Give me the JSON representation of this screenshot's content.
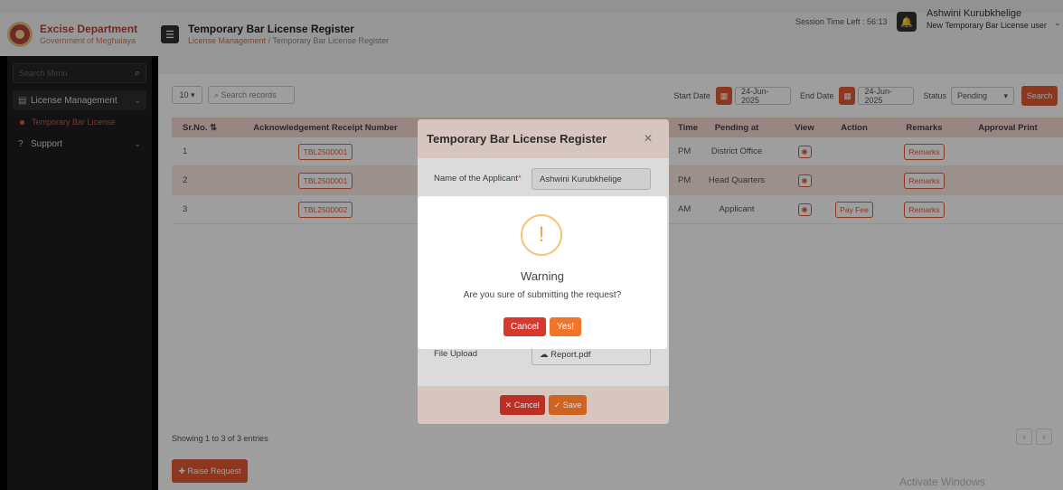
{
  "header": {
    "brand_title": "Excise Department",
    "brand_sub": "Government of Meghalaya",
    "page_title": "Temporary Bar License Register",
    "breadcrumb_link": "License Management",
    "breadcrumb_sep": " / ",
    "breadcrumb_current": "Temporary Bar License Register",
    "session_text": "Session Time Left : 56:13",
    "user_name": "Ashwini Kurubkhelige",
    "user_role": "New Temporary Bar License user"
  },
  "sidebar": {
    "search_placeholder": "Search Menu",
    "items": [
      {
        "label": "License Management"
      },
      {
        "label": "Support"
      }
    ],
    "subitem": "Temporary Bar License"
  },
  "toolbar": {
    "page_size": "10",
    "search_placeholder": "Search records",
    "start_label": "Start Date",
    "start_value": "24-Jun-2025",
    "end_label": "End Date",
    "end_value": "24-Jun-2025",
    "status_label": "Status",
    "status_value": "Pending",
    "search_button": "Search"
  },
  "table": {
    "headers": [
      "Sr.No.",
      "Acknowledgement Receipt Number",
      "Time",
      "Pending at",
      "View",
      "Action",
      "Remarks",
      "Approval Print"
    ],
    "rows": [
      {
        "sr": "1",
        "receipt": "TBL2500001",
        "time": "PM",
        "pending": "District Office",
        "action": "",
        "remarks": "Remarks"
      },
      {
        "sr": "2",
        "receipt": "TBL2500001",
        "time": "PM",
        "pending": "Head Quarters",
        "action": "",
        "remarks": "Remarks"
      },
      {
        "sr": "3",
        "receipt": "TBL2500002",
        "time": "AM",
        "pending": "Applicant",
        "action": "Pay Fee",
        "remarks": "Remarks"
      }
    ]
  },
  "footer": {
    "showing": "Showing 1 to 3 of 3 entries",
    "raise_button": "Raise Request",
    "watermark": "Activate Windows"
  },
  "form_modal": {
    "title": "Temporary Bar License Register",
    "applicant_label": "Name of the Applicant",
    "applicant_value": "Ashwini Kurubkhelige",
    "file_label": "File Upload",
    "file_value": "Report.pdf",
    "cancel_label": "Cancel",
    "save_label": "Save"
  },
  "confirm": {
    "title": "Warning",
    "message": "Are you sure of submitting the request?",
    "cancel_label": "Cancel",
    "yes_label": "Yes!"
  }
}
